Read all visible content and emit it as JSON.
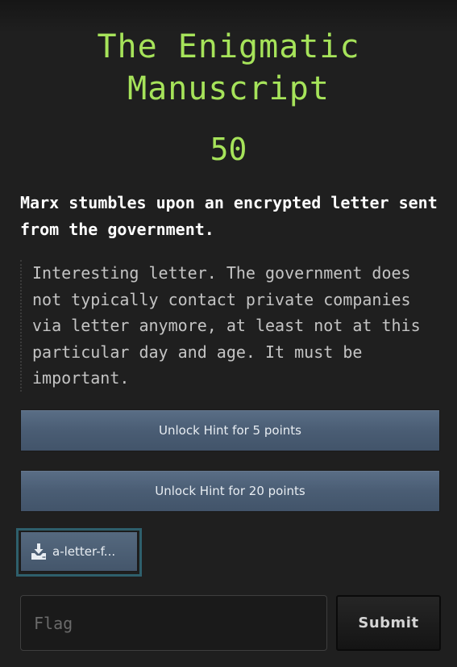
{
  "challenge": {
    "title_line1": "The Enigmatic",
    "title_line2": "Manuscript",
    "points": "50",
    "description": "Marx stumbles upon an encrypted letter sent from the government.",
    "quote": "Interesting letter. The government does not typically contact private companies via letter anymore, at least not at this particular day and age. It must be important."
  },
  "hints": [
    {
      "label": "Unlock Hint for 5 points"
    },
    {
      "label": "Unlock Hint for 20 points"
    }
  ],
  "file": {
    "label": "a-letter-f...",
    "icon": "download-icon"
  },
  "flag_form": {
    "placeholder": "Flag",
    "submit_label": "Submit"
  },
  "colors": {
    "accent": "#a6e35a",
    "background": "#1f1f1f",
    "hint_button": "#4a5d74",
    "file_focus_ring": "#2e5f6c"
  }
}
